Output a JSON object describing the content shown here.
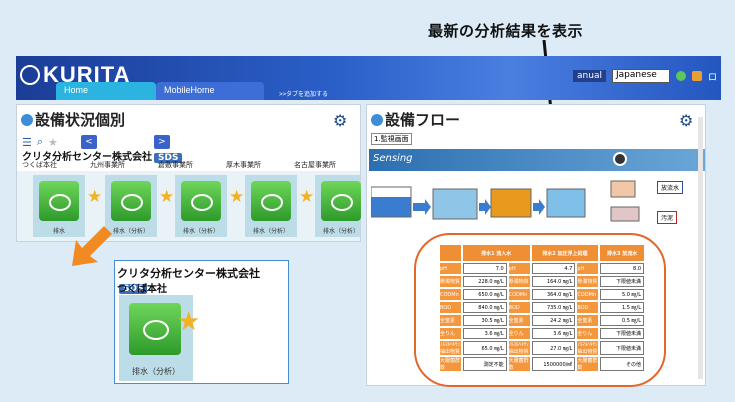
{
  "callout": "最新の分析結果を表示",
  "header": {
    "logo_text": "KURITA",
    "tabs": [
      {
        "label": "Home"
      },
      {
        "label": "MobileHome"
      }
    ],
    "add_tab": ">>タブを追加する",
    "manual": "anual",
    "language": "Japanese",
    "user": "ロ"
  },
  "left": {
    "title": "設備状況個別",
    "company": "クリタ分析センター株式会社",
    "sds": "SDS",
    "site_main": "つくば本社",
    "sites": [
      "九州事業所",
      "倉敷事業所",
      "厚木事業所",
      "名古屋事業所"
    ],
    "card_label": "排水（分析）",
    "card_label_short": "排水"
  },
  "zoom": {
    "company": "クリタ分析センター株式会社",
    "sds": "SDS",
    "site": "つくば本社",
    "card_label": "排水（分析）"
  },
  "right": {
    "title": "設備フロー",
    "select": "1.監視画面",
    "sensing": "Sensing",
    "outputs": [
      "放流水",
      "汚泥"
    ],
    "columns": [
      "排水1\n流入水",
      "排水2\n加圧浮上処理",
      "排水3\n放流水"
    ],
    "rows": [
      {
        "k": "pH",
        "v": [
          "7.0",
          "4.7",
          "8.0"
        ]
      },
      {
        "k": "懸濁物質",
        "v": [
          "228.0 ㎎/L",
          "164.0 ㎎/L",
          "下限値未満"
        ]
      },
      {
        "k": "CODMn",
        "v": [
          "650.0 ㎎/L",
          "364.0 ㎎/L",
          "5.0 ㎎/L"
        ]
      },
      {
        "k": "BOD",
        "v": [
          "840.0 ㎎/L",
          "735.0 ㎎/L",
          "1.5 ㎎/L"
        ]
      },
      {
        "k": "全窒素",
        "v": [
          "30.5 ㎎/L",
          "24.2 ㎎/L",
          "0.5 ㎎/L"
        ]
      },
      {
        "k": "全りん",
        "v": [
          "3.6 ㎎/L",
          "3.6 ㎎/L",
          "下限値未満"
        ]
      },
      {
        "k": "ﾉﾙﾏﾙﾍｷｻﾝ抽出物質",
        "v": [
          "65.0 ㎎/L",
          "27.0 ㎎/L",
          "下限値未満"
        ]
      },
      {
        "k": "大腸菌群数",
        "v": [
          "測定不能",
          "1500000/㎖",
          "その他"
        ]
      }
    ]
  }
}
